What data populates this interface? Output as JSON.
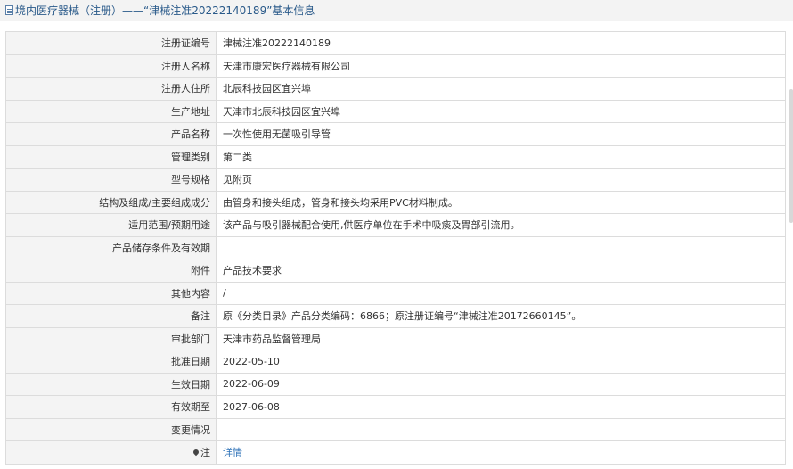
{
  "header": {
    "title": "境内医疗器械（注册）——“津械注准20222140189”基本信息"
  },
  "rows": [
    {
      "label": "注册证编号",
      "value": "津械注准20222140189"
    },
    {
      "label": "注册人名称",
      "value": "天津市康宏医疗器械有限公司"
    },
    {
      "label": "注册人住所",
      "value": "北辰科技园区宜兴埠"
    },
    {
      "label": "生产地址",
      "value": "天津市北辰科技园区宜兴埠"
    },
    {
      "label": "产品名称",
      "value": "一次性使用无菌吸引导管"
    },
    {
      "label": "管理类别",
      "value": "第二类"
    },
    {
      "label": "型号规格",
      "value": "见附页"
    },
    {
      "label": "结构及组成/主要组成成分",
      "value": "由管身和接头组成，管身和接头均采用PVC材料制成。"
    },
    {
      "label": "适用范围/预期用途",
      "value": "该产品与吸引器械配合使用,供医疗单位在手术中吸痰及胃部引流用。"
    },
    {
      "label": "产品储存条件及有效期",
      "value": ""
    },
    {
      "label": "附件",
      "value": "产品技术要求"
    },
    {
      "label": "其他内容",
      "value": "/"
    },
    {
      "label": "备注",
      "value": "原《分类目录》产品分类编码：6866；原注册证编号“津械注准20172660145”。"
    },
    {
      "label": "审批部门",
      "value": "天津市药品监督管理局"
    },
    {
      "label": "批准日期",
      "value": "2022-05-10"
    },
    {
      "label": "生效日期",
      "value": "2022-06-09"
    },
    {
      "label": "有效期至",
      "value": "2027-06-08"
    },
    {
      "label": "变更情况",
      "value": ""
    }
  ],
  "note": {
    "label": "注",
    "link": "详情",
    "icon": "pin-icon"
  }
}
